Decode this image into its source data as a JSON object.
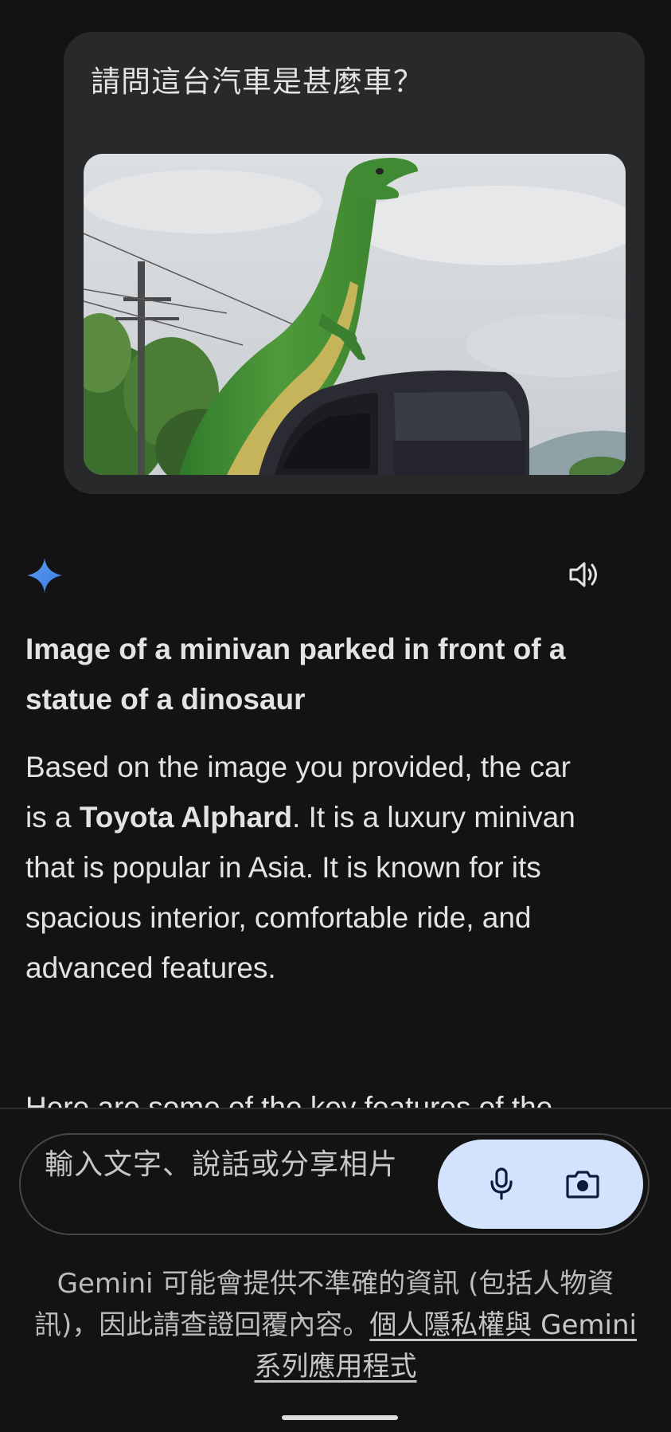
{
  "prompt": {
    "text": "請問這台汽車是甚麼車？"
  },
  "response": {
    "title": "Image of a minivan parked in front of a statue of a dinosaur",
    "body_before": "Based on the image you provided, the car is a ",
    "body_bold": "Toyota Alphard",
    "body_after": ". It is a luxury minivan that is popular in Asia. It is known for its spacious interior, comfortable ride, and advanced features.",
    "next_line_partial": "Here are some of the key features of the"
  },
  "input": {
    "placeholder": "輸入文字、說話或分享相片"
  },
  "icons": {
    "spark": "gemini-spark-icon",
    "speaker": "volume-icon",
    "mic": "mic-icon",
    "camera": "camera-icon"
  },
  "disclaimer": {
    "text": "Gemini 可能會提供不準確的資訊 (包括人物資訊)，因此請查證回覆內容。",
    "link": "個人隱私權與 Gemini 系列應用程式"
  },
  "colors": {
    "background": "#131314",
    "bubble": "#28292a",
    "accent": "#d3e3fd",
    "spark_blue": "#4a90e2"
  }
}
